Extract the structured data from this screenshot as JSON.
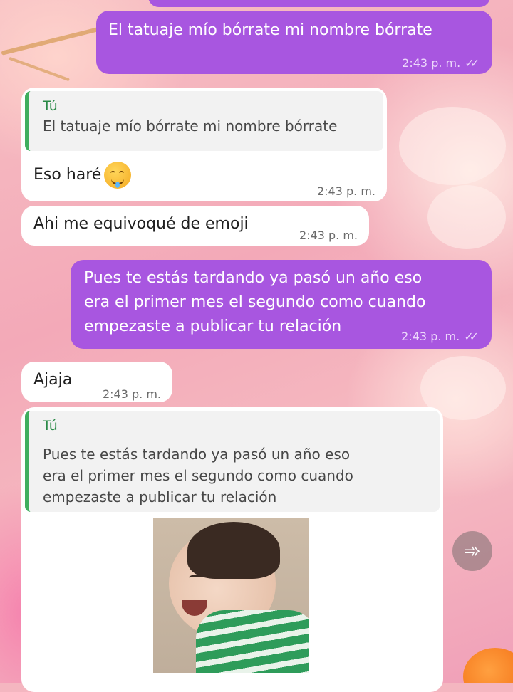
{
  "messages": [
    {
      "id": "m1",
      "direction": "out",
      "lines": [
        "El tatuaje mío bórrate mi nombre bórrate"
      ],
      "time": "2:43 p. m.",
      "status_icon": "double-check-icon"
    },
    {
      "id": "m2",
      "direction": "in",
      "quote": {
        "author": "Tú",
        "lines": [
          "El tatuaje mío bórrate mi nombre bórrate"
        ]
      },
      "lines": [
        "Eso haré"
      ],
      "emoji": "drooling-face-emoji",
      "time": "2:43 p. m."
    },
    {
      "id": "m3",
      "direction": "in",
      "lines": [
        "Ahi me equivoqué de emoji"
      ],
      "time": "2:43 p. m."
    },
    {
      "id": "m4",
      "direction": "out",
      "lines": [
        "Pues te estás tardando ya pasó un año eso",
        "era el primer mes el segundo como cuando",
        "empezaste a publicar tu relación"
      ],
      "time": "2:43 p. m.",
      "status_icon": "double-check-icon"
    },
    {
      "id": "m5",
      "direction": "in",
      "lines": [
        "Ajaja"
      ],
      "time": "2:43 p. m."
    },
    {
      "id": "m6",
      "direction": "in",
      "quote": {
        "author": "Tú",
        "lines": [
          "Pues te estás tardando ya pasó un año eso",
          "era el primer mes el segundo como cuando",
          "empezaste a publicar tu relación"
        ]
      },
      "sticker": "laughing-baby-sticker"
    }
  ],
  "forward_icon": "forward-icon",
  "colors": {
    "outgoing_bubble": "#a856e0",
    "incoming_bubble": "#ffffff",
    "quote_bar": "#3fae5e",
    "quote_author": "#2a8a47"
  }
}
